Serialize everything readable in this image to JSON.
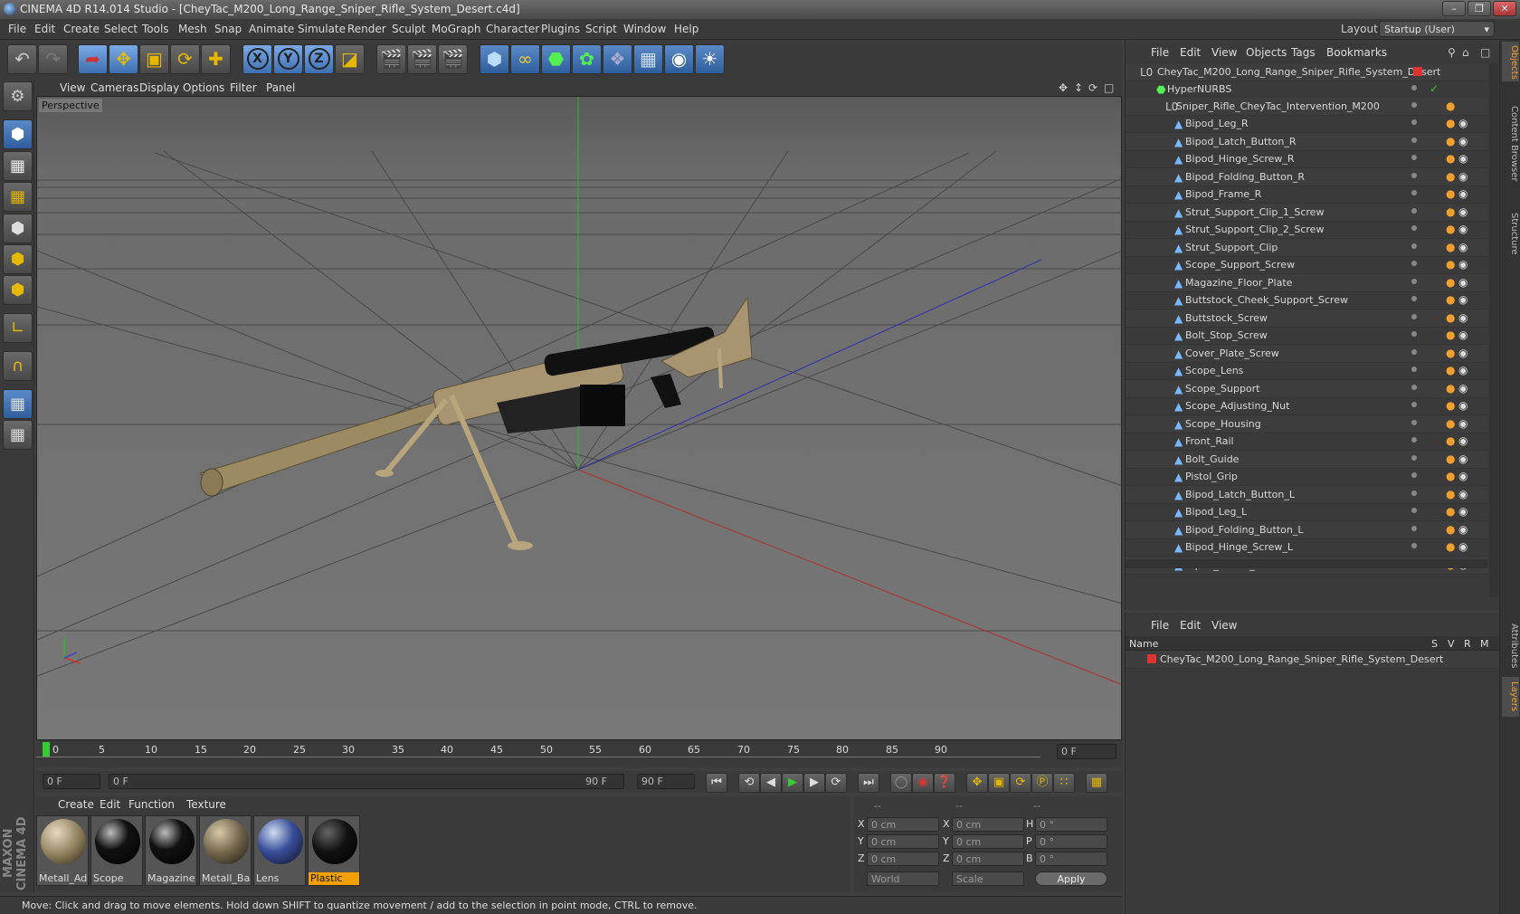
{
  "window": {
    "title": "CINEMA 4D R14.014 Studio - [CheyTac_M200_Long_Range_Sniper_Rifle_System_Desert.c4d]"
  },
  "menu": [
    "File",
    "Edit",
    "Create",
    "Select",
    "Tools",
    "Mesh",
    "Snap",
    "Animate",
    "Simulate",
    "Render",
    "Sculpt",
    "MoGraph",
    "Character",
    "Plugins",
    "Script",
    "Window",
    "Help"
  ],
  "layout": {
    "label": "Layout:",
    "value": "Startup (User)"
  },
  "viewport": {
    "menu": [
      "View",
      "Cameras",
      "Display",
      "Options",
      "Filter",
      "Panel"
    ],
    "label": "Perspective"
  },
  "timeline": {
    "ticks": [
      "0",
      "5",
      "10",
      "15",
      "20",
      "25",
      "30",
      "35",
      "40",
      "45",
      "50",
      "55",
      "60",
      "65",
      "70",
      "75",
      "80",
      "85",
      "90"
    ],
    "end_field": "0 F",
    "start_field": "0 F",
    "range_start": "0 F",
    "range_end": "90 F",
    "max_field": "90 F"
  },
  "materials": {
    "menu": [
      "Create",
      "Edit",
      "Function",
      "Texture"
    ],
    "items": [
      {
        "name": "Metall_Adc"
      },
      {
        "name": "Scope"
      },
      {
        "name": "Magazine"
      },
      {
        "name": "Metall_Bas"
      },
      {
        "name": "Lens"
      },
      {
        "name": "Plastic"
      }
    ]
  },
  "coords": {
    "headers": [
      "--",
      "--",
      "--"
    ],
    "rows": [
      {
        "a": "X",
        "av": "0 cm",
        "b": "X",
        "bv": "0 cm",
        "c": "H",
        "cv": "0 °"
      },
      {
        "a": "Y",
        "av": "0 cm",
        "b": "Y",
        "bv": "0 cm",
        "c": "P",
        "cv": "0 °"
      },
      {
        "a": "Z",
        "av": "0 cm",
        "b": "Z",
        "bv": "0 cm",
        "c": "B",
        "cv": "0 °"
      }
    ],
    "world": "World",
    "scale": "Scale",
    "apply": "Apply"
  },
  "status": "Move: Click and drag to move elements. Hold down SHIFT to quantize movement / add to the selection in point mode, CTRL to remove.",
  "objects": {
    "menu": [
      "File",
      "Edit",
      "View",
      "Objects",
      "Tags",
      "Bookmarks"
    ],
    "root": "CheyTac_M200_Long_Range_Sniper_Rifle_System_Desert",
    "nurbs": "HyperNURBS",
    "group": "Sniper_Rifle_CheyTac_Intervention_M200",
    "items": [
      "Bipod_Leg_R",
      "Bipod_Latch_Button_R",
      "Bipod_Hinge_Screw_R",
      "Bipod_Folding_Button_R",
      "Bipod_Frame_R",
      "Strut_Support_Clip_1_Screw",
      "Strut_Support_Clip_2_Screw",
      "Strut_Support_Clip",
      "Scope_Support_Screw",
      "Magazine_Floor_Plate",
      "Buttstock_Cheek_Support_Screw",
      "Buttstock_Screw",
      "Bolt_Stop_Screw",
      "Cover_Plate_Screw",
      "Scope_Lens",
      "Scope_Support",
      "Scope_Adjusting_Nut",
      "Scope_Housing",
      "Front_Rail",
      "Bolt_Guide",
      "Pistol_Grip",
      "Bipod_Latch_Button_L",
      "Bipod_Leg_L",
      "Bipod_Folding_Button_L",
      "Bipod_Hinge_Screw_L",
      "Bipod_Frame_L"
    ]
  },
  "layers": {
    "menu": [
      "File",
      "Edit",
      "View"
    ],
    "columns": [
      "Name",
      "S",
      "V",
      "R",
      "M"
    ],
    "row": "CheyTac_M200_Long_Range_Sniper_Rifle_System_Desert"
  },
  "sidetabs": [
    "Objects",
    "Content Browser",
    "Structure",
    "Attributes",
    "Layers"
  ]
}
